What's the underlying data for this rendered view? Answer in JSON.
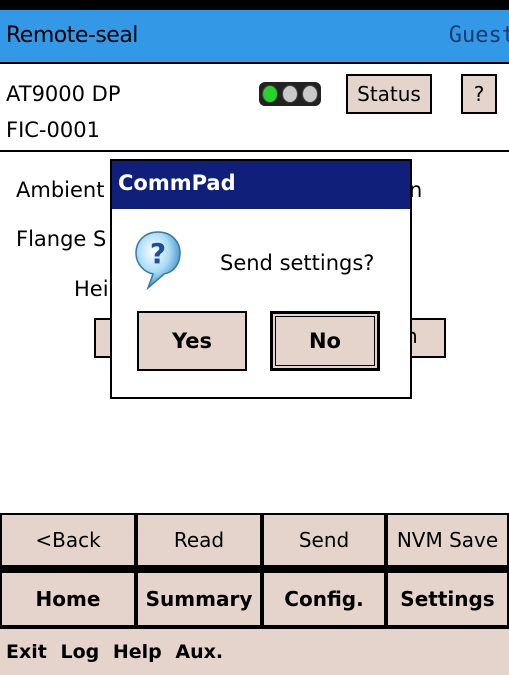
{
  "titlebar": {
    "app_title": "Remote-seal",
    "user": "Guest"
  },
  "header": {
    "device_model": "AT9000 DP",
    "device_tag": "FIC-0001",
    "status_label": "Status",
    "help_label": "?"
  },
  "main": {
    "params": [
      "Ambient",
      "Flange S",
      "Hei"
    ],
    "partial_trailing": [
      "n",
      "n"
    ]
  },
  "dialog": {
    "title": "CommPad",
    "message": "Send settings?",
    "yes_label": "Yes",
    "no_label": "No"
  },
  "nav": {
    "back": "<Back",
    "read": "Read",
    "send": "Send",
    "nvm_save": "NVM Save"
  },
  "menu": {
    "home": "Home",
    "summary": "Summary",
    "config": "Config.",
    "settings": "Settings"
  },
  "footer": {
    "items": [
      "Exit",
      "Log",
      "Help",
      "Aux."
    ]
  },
  "colors": {
    "titlebar": "#3399e6",
    "dialog_titlebar": "#10207a",
    "button_face": "#e4d4cc",
    "light_on": "#28d228"
  }
}
